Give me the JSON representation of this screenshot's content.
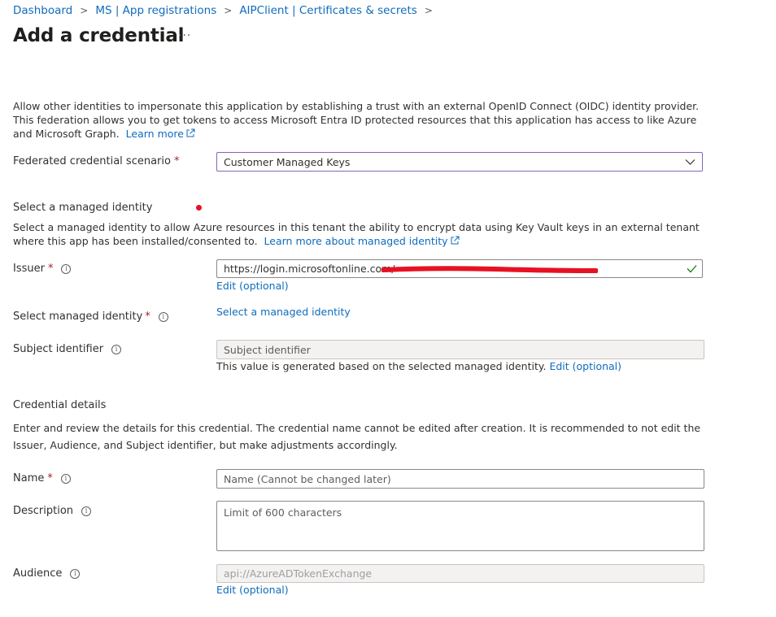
{
  "breadcrumb": [
    "Dashboard",
    "MS | App registrations",
    "AIPClient | Certificates & secrets"
  ],
  "page": {
    "title": "Add a credential",
    "more": "···"
  },
  "intro": {
    "text": "Allow other identities to impersonate this application by establishing a trust with an external OpenID Connect (OIDC) identity provider. This federation allows you to get tokens to access Microsoft Entra ID protected resources that this application has access to like Azure and Microsoft Graph.",
    "learn_more": "Learn more"
  },
  "scenario": {
    "label": "Federated credential scenario",
    "value": "Customer Managed Keys"
  },
  "managed_identity_section": {
    "heading": "Select a managed identity",
    "description": "Select a managed identity to allow Azure resources in this tenant the ability to encrypt data using Key Vault keys in an external tenant where this app has been installed/consented to.",
    "learn_more": "Learn more about managed identity"
  },
  "issuer": {
    "label": "Issuer",
    "value": "https://login.microsoftonline.com/",
    "edit": "Edit (optional)"
  },
  "select_identity": {
    "label": "Select managed identity",
    "link": "Select a managed identity"
  },
  "subject": {
    "label": "Subject identifier",
    "value": "Subject identifier",
    "note": "This value is generated based on the selected managed identity.",
    "edit": "Edit (optional)"
  },
  "credential_details": {
    "heading": "Credential details",
    "description": "Enter and review the details for this credential. The credential name cannot be edited after creation. It is recommended to not edit the Issuer, Audience, and Subject identifier, but make adjustments accordingly."
  },
  "name": {
    "label": "Name",
    "placeholder": "Name (Cannot be changed later)"
  },
  "description": {
    "label": "Description",
    "placeholder": "Limit of 600 characters"
  },
  "audience": {
    "label": "Audience",
    "value": "api://AzureADTokenExchange",
    "edit": "Edit (optional)"
  },
  "colors": {
    "link": "#0f6cbd",
    "required": "#a4262c",
    "focus_border": "#8764b8",
    "valid_check": "#107c10",
    "redaction": "#e81123"
  }
}
